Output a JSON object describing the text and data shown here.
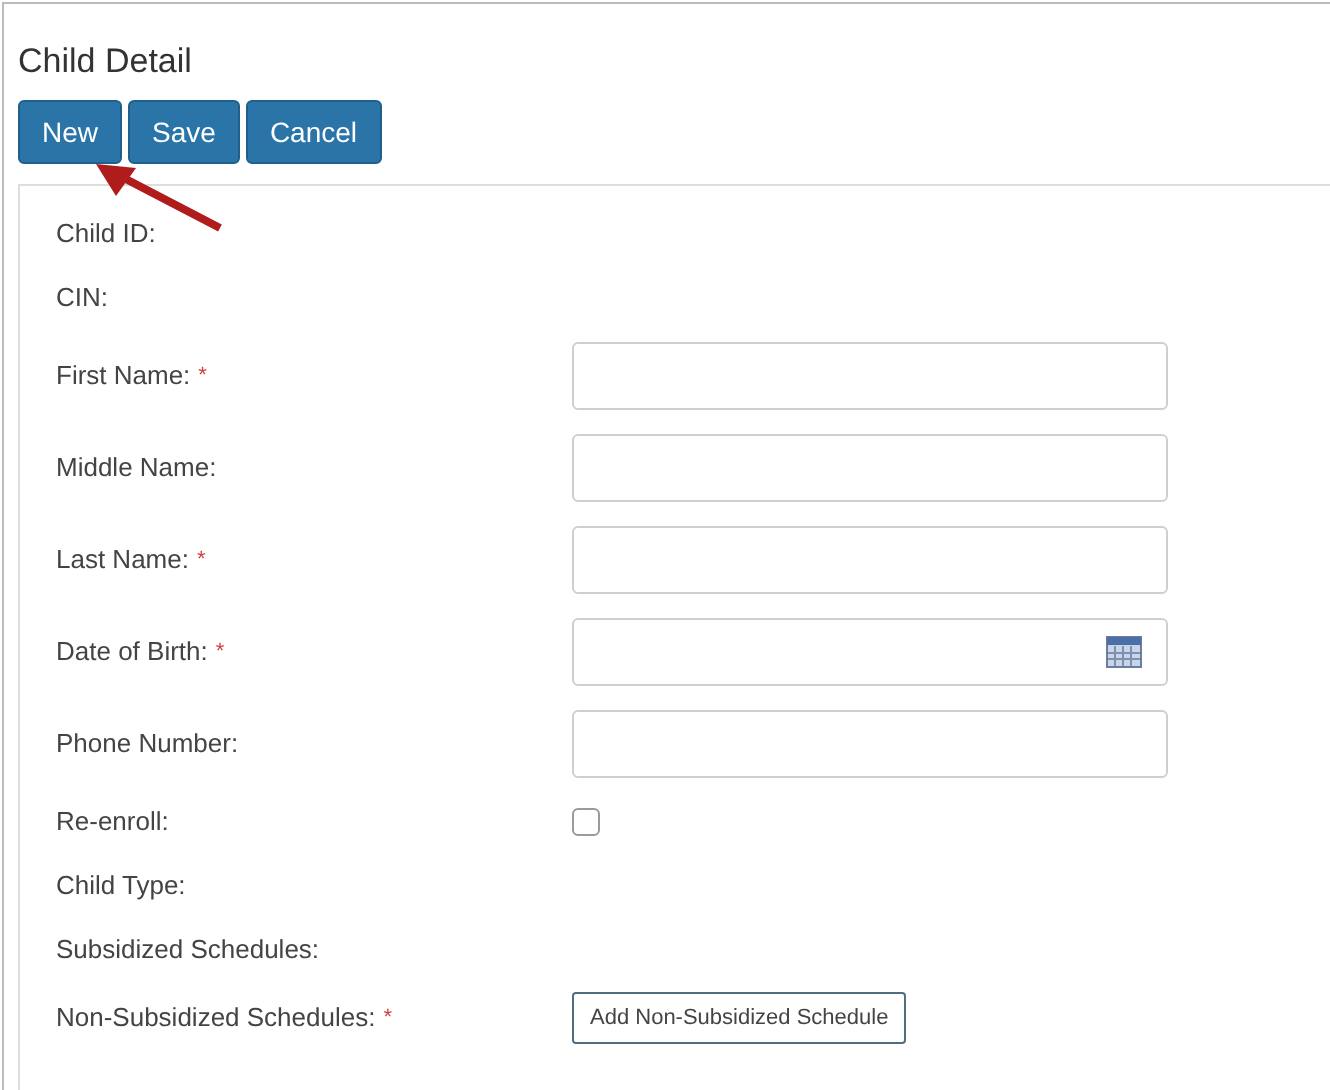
{
  "title": "Child Detail",
  "buttons": [
    "New",
    "Save",
    "Cancel"
  ],
  "fields": [
    {
      "kind": "text",
      "label": "Child ID:",
      "required": false
    },
    {
      "kind": "text",
      "label": "CIN:",
      "required": false
    },
    {
      "kind": "input",
      "label": "First Name:",
      "required": true
    },
    {
      "kind": "input",
      "label": "Middle Name:",
      "required": false
    },
    {
      "kind": "input",
      "label": "Last Name:",
      "required": true
    },
    {
      "kind": "date",
      "label": "Date of Birth:",
      "required": true
    },
    {
      "kind": "input",
      "label": "Phone Number:",
      "required": false
    },
    {
      "kind": "checkbox",
      "label": "Re-enroll:",
      "required": false,
      "checked": false
    },
    {
      "kind": "text",
      "label": "Child Type:",
      "required": false
    },
    {
      "kind": "text",
      "label": "Subsidized Schedules:",
      "required": false
    },
    {
      "kind": "button",
      "label": "Non-Subsidized Schedules:",
      "required": true,
      "button": "Add Non-Subsidized Schedule"
    }
  ],
  "required_mark": "*"
}
